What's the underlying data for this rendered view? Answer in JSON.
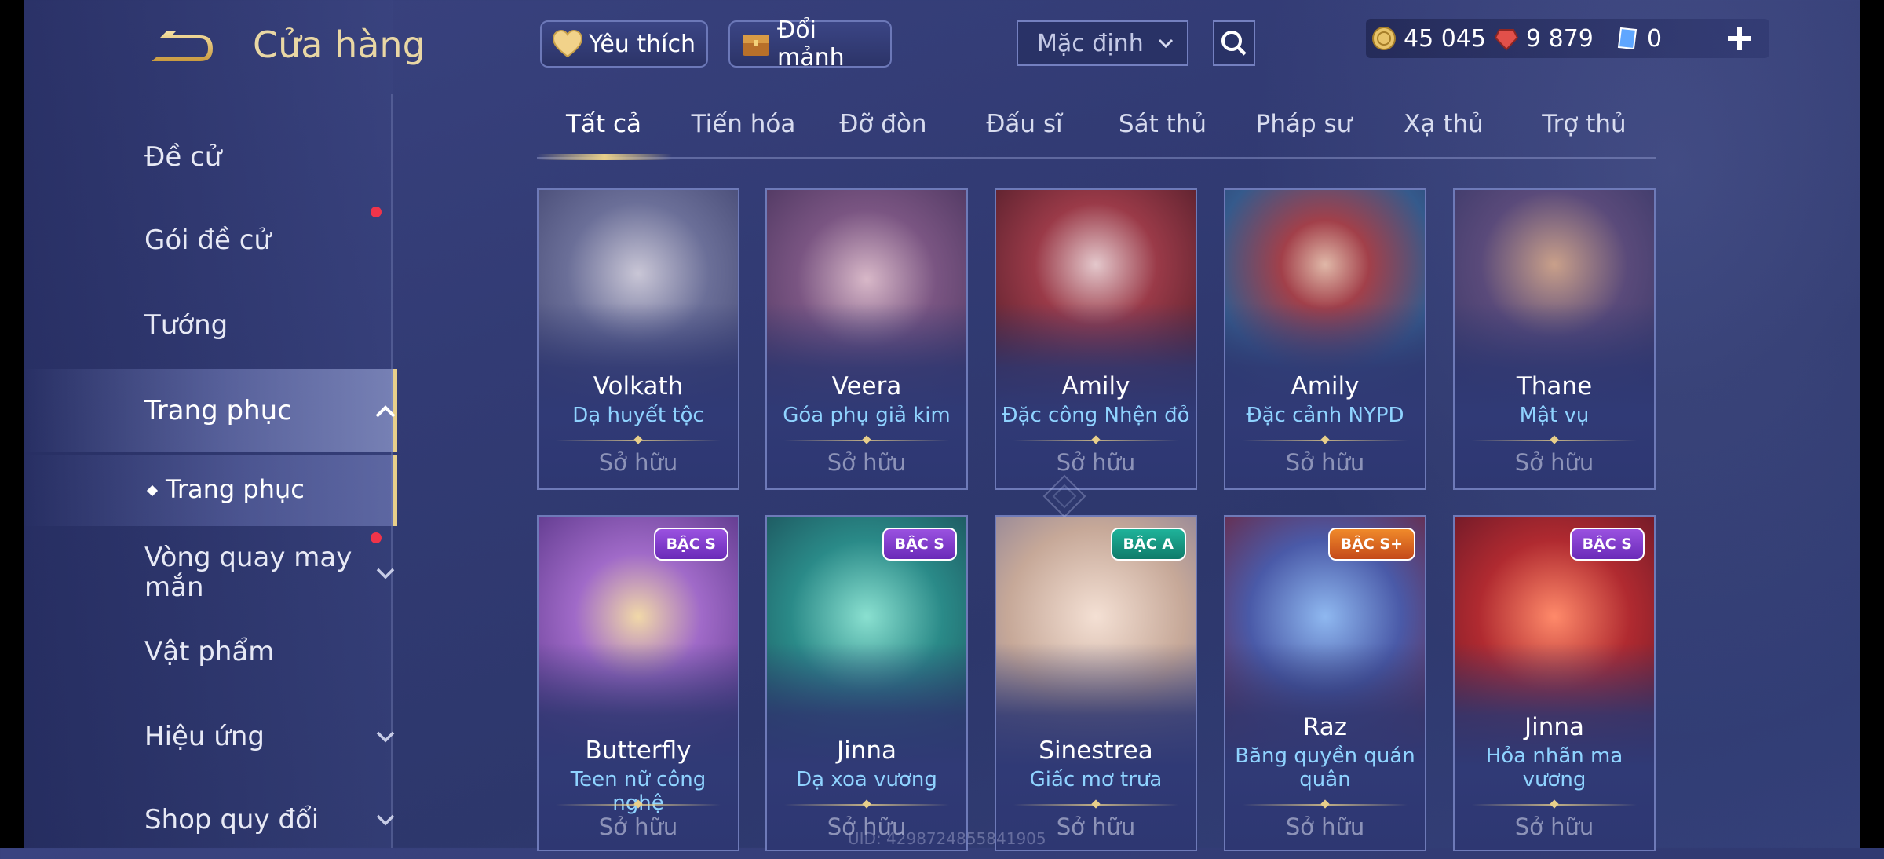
{
  "header": {
    "title": "Cửa hàng",
    "favorites_label": "Yêu thích",
    "exchange_label": "Đổi mảnh",
    "sort": {
      "selected": "Mặc định"
    }
  },
  "currencies": [
    {
      "icon": "gold-coin-icon",
      "value": "45 045",
      "color": "#e8c46a"
    },
    {
      "icon": "ruby-gem-icon",
      "value": "9 879",
      "color": "#e2504a"
    },
    {
      "icon": "voucher-card-icon",
      "value": "0",
      "color": "#5fa6ff"
    }
  ],
  "sidebar": {
    "items": [
      {
        "label": "Đề cử",
        "has_chevron": false,
        "has_badge": false
      },
      {
        "label": "Gói đề cử",
        "has_chevron": false,
        "has_badge": true
      },
      {
        "label": "Tướng",
        "has_chevron": false,
        "has_badge": false
      },
      {
        "label": "Trang phục",
        "has_chevron": true,
        "expanded": true,
        "active": true
      },
      {
        "label": "Vòng quay may mắn",
        "has_chevron": true,
        "has_badge": true
      },
      {
        "label": "Vật phẩm",
        "has_chevron": false,
        "has_badge": false
      },
      {
        "label": "Hiệu ứng",
        "has_chevron": true,
        "has_badge": false
      },
      {
        "label": "Shop quy đổi",
        "has_chevron": true,
        "has_badge": false
      }
    ],
    "subitem": {
      "label": "Trang phục",
      "active": true
    }
  },
  "tabs": [
    {
      "label": "Tất cả",
      "active": true
    },
    {
      "label": "Tiến hóa"
    },
    {
      "label": "Đỡ đòn"
    },
    {
      "label": "Đấu sĩ"
    },
    {
      "label": "Sát thủ"
    },
    {
      "label": "Pháp sư"
    },
    {
      "label": "Xạ thủ"
    },
    {
      "label": "Trợ thủ"
    }
  ],
  "skins": [
    {
      "hero": "Volkath",
      "skin": "Dạ huyết tộc",
      "status": "Sở hữu",
      "tier": "",
      "art_color": "#5a6a9a"
    },
    {
      "hero": "Veera",
      "skin": "Góa phụ giả kim",
      "status": "Sở hữu",
      "tier": "",
      "art_color": "#6a4a7a"
    },
    {
      "hero": "Amily",
      "skin": "Đặc công Nhện đỏ",
      "status": "Sở hữu",
      "tier": "",
      "art_color": "#5a2030"
    },
    {
      "hero": "Amily",
      "skin": "Đặc cảnh NYPD",
      "status": "Sở hữu",
      "tier": "",
      "art_color": "#3a5a8a"
    },
    {
      "hero": "Thane",
      "skin": "Mật vụ",
      "status": "Sở hữu",
      "tier": "",
      "art_color": "#3a4a7a"
    },
    {
      "hero": "Butterfly",
      "skin": "Teen nữ công nghệ",
      "status": "Sở hữu",
      "tier": "BẬC S",
      "art_color": "#6a3a9a"
    },
    {
      "hero": "Jinna",
      "skin": "Dạ xoa vương",
      "status": "Sở hữu",
      "tier": "BẬC S",
      "art_color": "#1f6a6a"
    },
    {
      "hero": "Sinestrea",
      "skin": "Giấc mơ trưa",
      "status": "Sở hữu",
      "tier": "BẬC A",
      "art_color": "#c9a99a"
    },
    {
      "hero": "Raz",
      "skin": "Băng quyền quán quân",
      "status": "Sở hữu",
      "tier": "BẬC S+",
      "art_color": "#2a3a7a"
    },
    {
      "hero": "Jinna",
      "skin": "Hỏa nhãn ma vương",
      "status": "Sở hữu",
      "tier": "BẬC S",
      "art_color": "#7a1a20"
    }
  ],
  "footer": {
    "uid": "UID: 4298724855841905"
  },
  "colors": {
    "accent_gold": "#e8cf8a",
    "skin_name": "#8fd3ff",
    "badge_red": "#f0344a"
  }
}
